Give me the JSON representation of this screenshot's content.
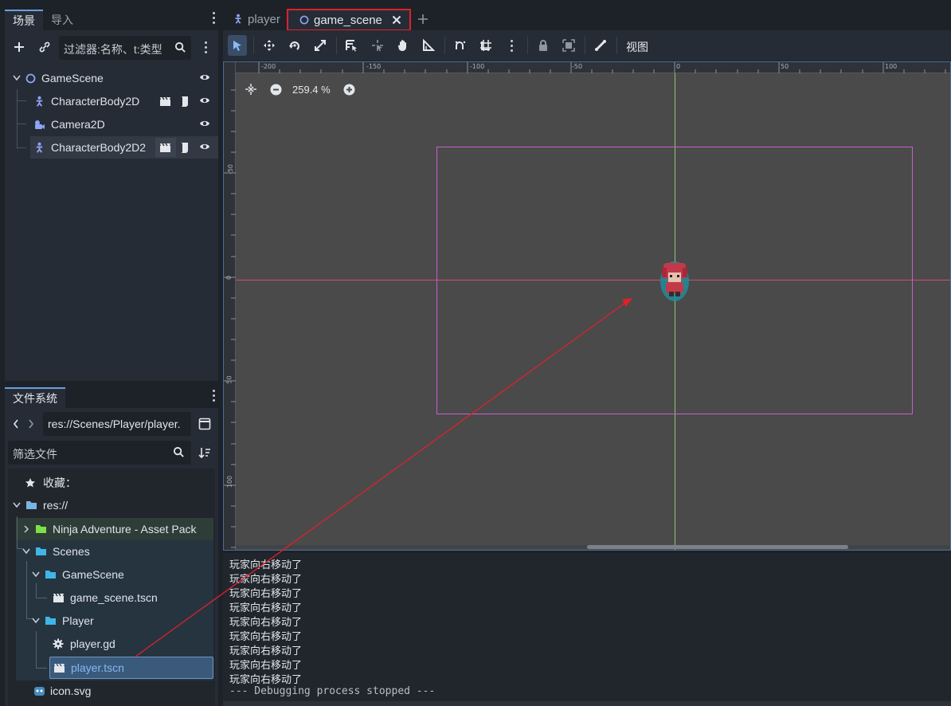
{
  "left_dock": {
    "scene_tabs": [
      "场景",
      "导入"
    ],
    "scene_filter_placeholder": "过滤器:名称、t:类型",
    "scene_tree": [
      {
        "label": "GameScene",
        "type": "Node2D"
      },
      {
        "label": "CharacterBody2D",
        "type": "CharacterBody2D"
      },
      {
        "label": "Camera2D",
        "type": "Camera2D"
      },
      {
        "label": "CharacterBody2D2",
        "type": "CharacterBody2D"
      }
    ],
    "fs_tab": "文件系统",
    "fs_path": "res://Scenes/Player/player.",
    "fs_filter_placeholder": "筛选文件",
    "fs_items": [
      {
        "label": "收藏：",
        "kind": "favorites"
      },
      {
        "label": "res://",
        "kind": "folder"
      },
      {
        "label": "Ninja Adventure - Asset Pack",
        "kind": "folder-green"
      },
      {
        "label": "Scenes",
        "kind": "folder"
      },
      {
        "label": "GameScene",
        "kind": "folder"
      },
      {
        "label": "game_scene.tscn",
        "kind": "scene"
      },
      {
        "label": "Player",
        "kind": "folder"
      },
      {
        "label": "player.gd",
        "kind": "script"
      },
      {
        "label": "player.tscn",
        "kind": "scene"
      },
      {
        "label": "icon.svg",
        "kind": "image"
      }
    ]
  },
  "editor_tabs": [
    {
      "label": "player",
      "active": false
    },
    {
      "label": "game_scene",
      "active": true
    }
  ],
  "toolbar": {
    "view_menu": "视图"
  },
  "viewport": {
    "zoom_label": "259.4 %",
    "ruler_x": [
      "-200",
      "-150",
      "-100",
      "-50",
      "0",
      "50",
      "100"
    ],
    "ruler_y": [
      "-50",
      "0",
      "50",
      "100"
    ]
  },
  "console": {
    "lines": [
      "玩家向右移动了",
      "玩家向右移动了",
      "玩家向右移动了",
      "玩家向右移动了",
      "玩家向右移动了",
      "玩家向右移动了",
      "玩家向右移动了",
      "玩家向右移动了",
      "玩家向右移动了"
    ],
    "status": "--- Debugging process stopped ---"
  },
  "colors": {
    "accent": "#6a9fe0",
    "annotation_red": "#e0202a",
    "camera_rect": "#c65ed0",
    "axis_x": "#d05070",
    "axis_y": "#8cc870"
  }
}
